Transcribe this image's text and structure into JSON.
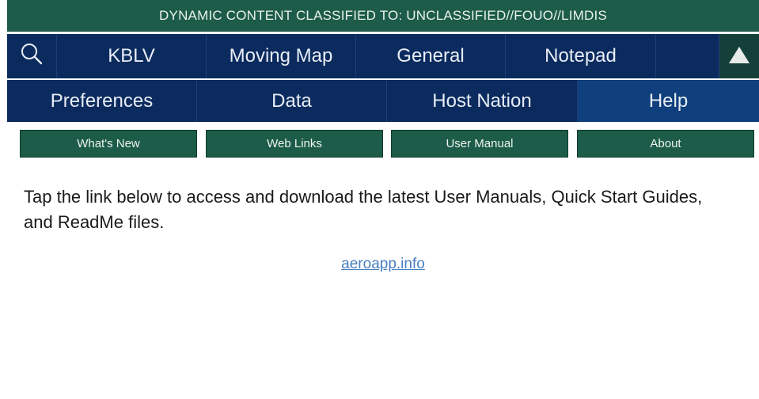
{
  "classification_banner": "DYNAMIC CONTENT CLASSIFIED TO: UNCLASSIFIED//FOUO//LIMDIS",
  "nav_top": {
    "items": [
      {
        "label": "KBLV"
      },
      {
        "label": "Moving Map"
      },
      {
        "label": "General"
      },
      {
        "label": "Notepad"
      }
    ]
  },
  "nav_second": {
    "items": [
      {
        "label": "Preferences"
      },
      {
        "label": "Data"
      },
      {
        "label": "Host Nation"
      },
      {
        "label": "Help"
      }
    ],
    "active": "Help"
  },
  "subtabs": {
    "items": [
      {
        "label": "What's New"
      },
      {
        "label": "Web Links"
      },
      {
        "label": "User Manual"
      },
      {
        "label": "About"
      }
    ]
  },
  "content": {
    "description": "Tap the link below to access and download the latest User Manuals, Quick Start Guides, and ReadMe files.",
    "link_text": "aeroapp.info"
  },
  "colors": {
    "banner_green": "#1d5c48",
    "nav_navy": "#0b2b5e",
    "nav_active": "#0f3f7c",
    "link_blue": "#4a7fc0"
  },
  "icons": {
    "search": "search-icon",
    "collapse": "triangle-up-icon"
  }
}
